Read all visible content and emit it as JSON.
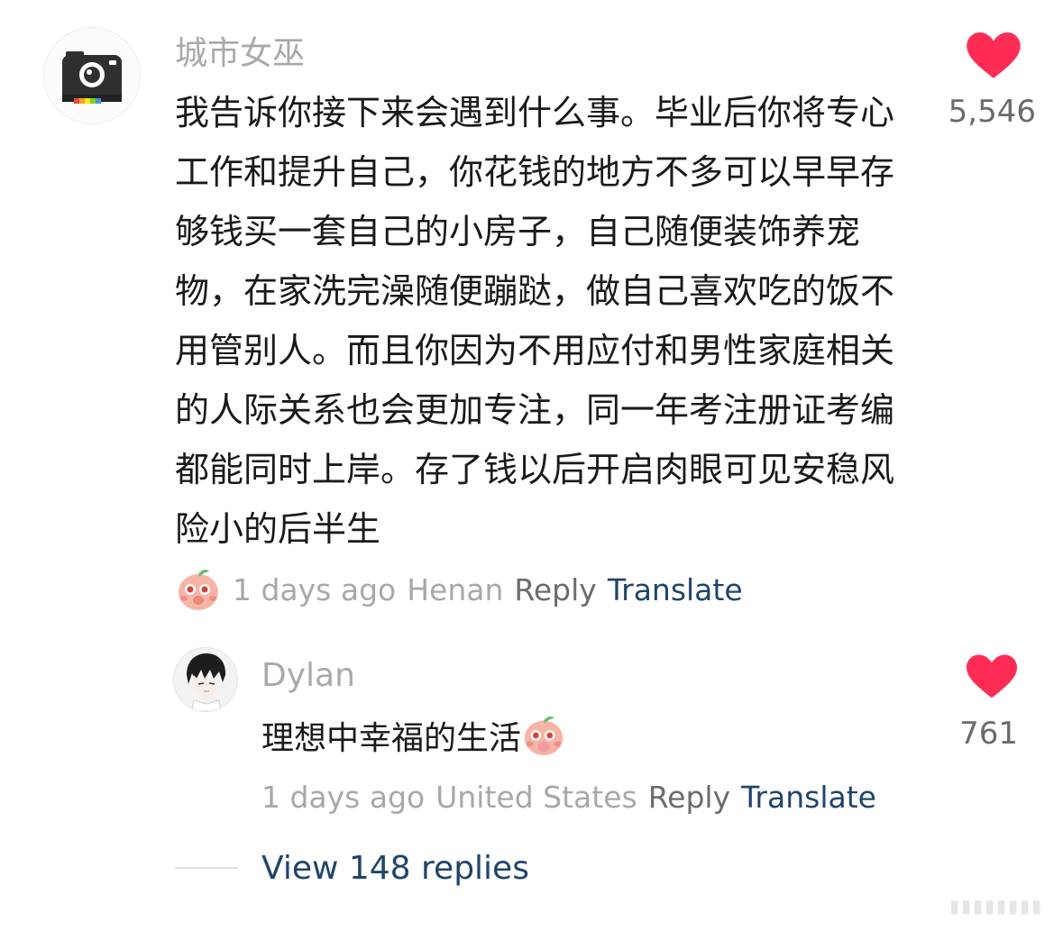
{
  "comment": {
    "username": "城市女巫",
    "avatar_icon": "camera-icon",
    "text": "我告诉你接下来会遇到什么事。毕业后你将专心工作和提升自己，你花钱的地方不多可以早早存够钱买一套自己的小房子，自己随便装饰养宠物，在家洗完澡随便蹦跶，做自己喜欢吃的饭不用管别人。而且你因为不用应付和男性家庭相关的人际关系也会更加专注，同一年考注册证考编都能同时上岸。存了钱以后开启肉眼可见安稳风险小的后半生",
    "sticker_icon": "peach-sticker-icon",
    "time": "1 days ago",
    "location": "Henan",
    "reply_label": "Reply",
    "translate_label": "Translate",
    "likes": "5,546"
  },
  "reply": {
    "username": "Dylan",
    "avatar_icon": "anime-avatar-icon",
    "text": "理想中幸福的生活",
    "sticker_icon": "peach-sticker-icon",
    "time": "1 days ago",
    "location": "United States",
    "reply_label": "Reply",
    "translate_label": "Translate",
    "likes": "761"
  },
  "view_replies": "View 148 replies",
  "colors": {
    "heart": "#fe2c55",
    "link_blue": "#20456a",
    "meta_gray": "#a8a8a8"
  }
}
